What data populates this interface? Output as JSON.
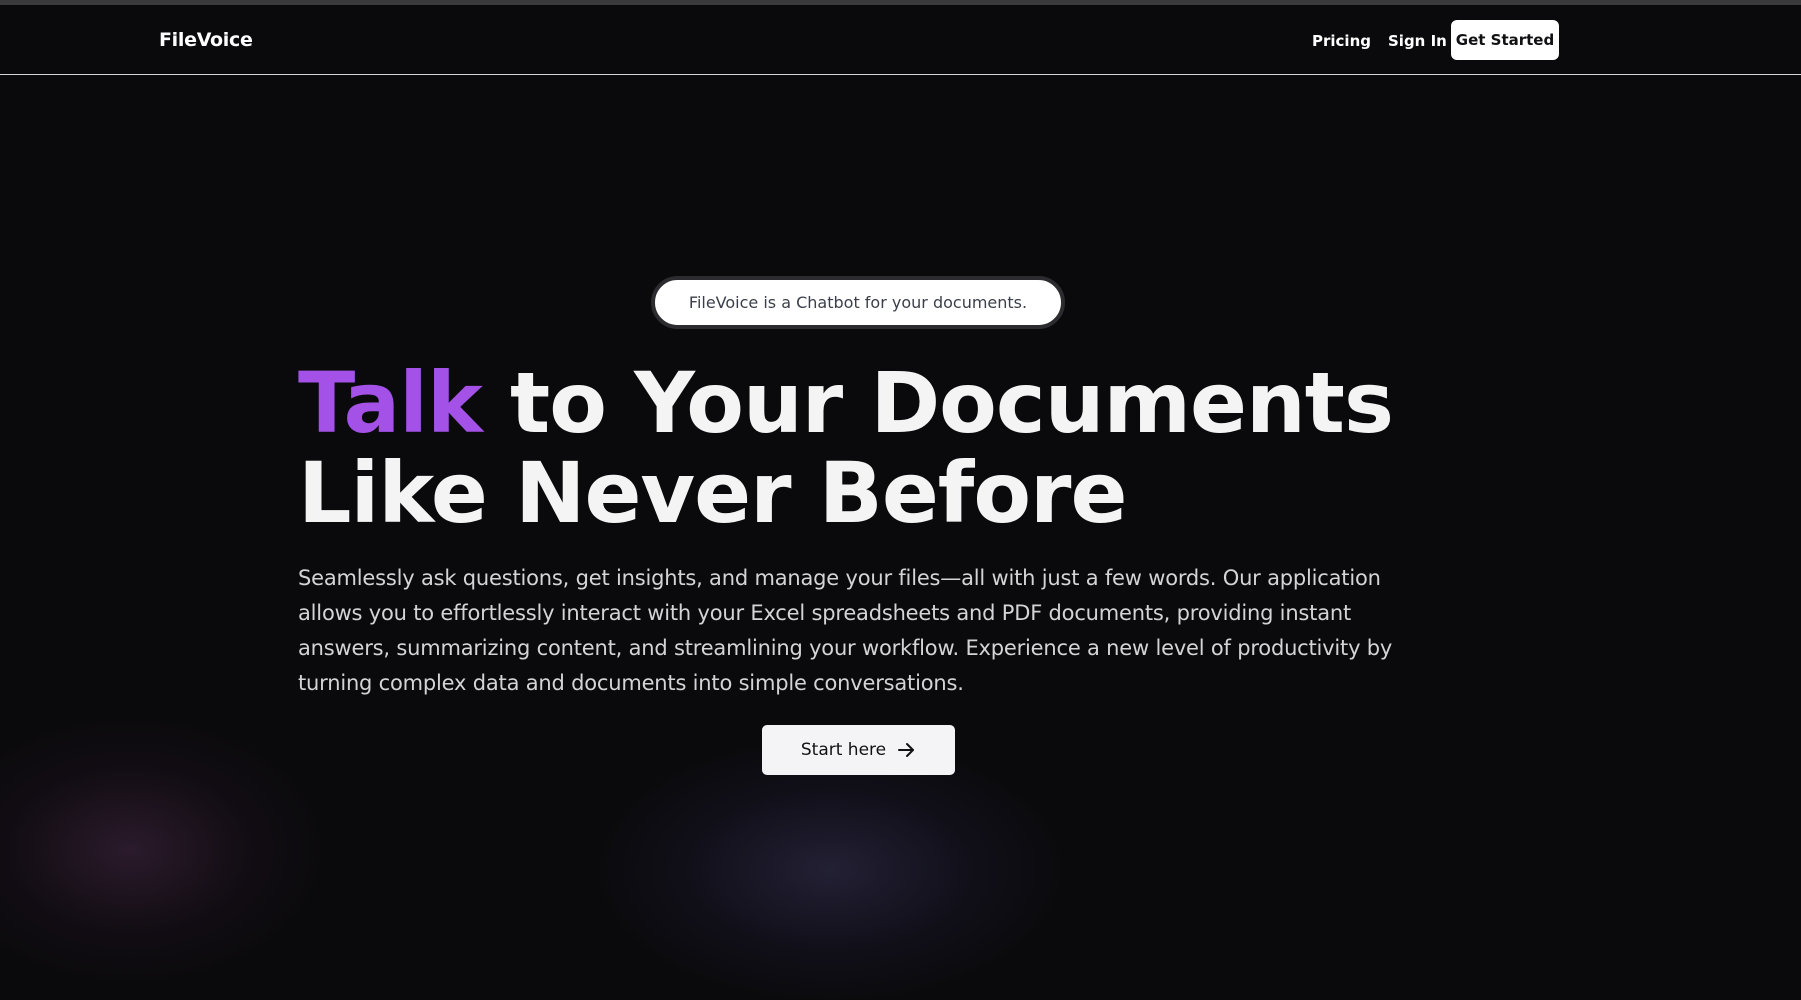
{
  "nav": {
    "brand": "FileVoice",
    "links": [
      "Pricing",
      "Sign In"
    ],
    "cta_label": "Get Started"
  },
  "hero": {
    "badge": "FileVoice is a Chatbot for your documents.",
    "headline_accent": "Talk",
    "headline_rest_line1": " to Your Documents",
    "headline_line2": "Like Never Before",
    "description": "Seamlessly ask questions, get insights, and manage your files—all with just a few words. Our application allows you to effortlessly interact with your Excel spreadsheets and PDF documents, providing instant answers, summarizing content, and streamlining your workflow. Experience a new level of productivity by turning complex data and documents into simple conversations.",
    "cta_label": "Start here",
    "cta_icon": "arrow-right-icon"
  },
  "colors": {
    "background": "#0a0a0c",
    "accent": "#a451e8",
    "text_primary": "#f4f4f5",
    "text_secondary": "#d4d4d8",
    "button_bg": "#ffffff"
  }
}
